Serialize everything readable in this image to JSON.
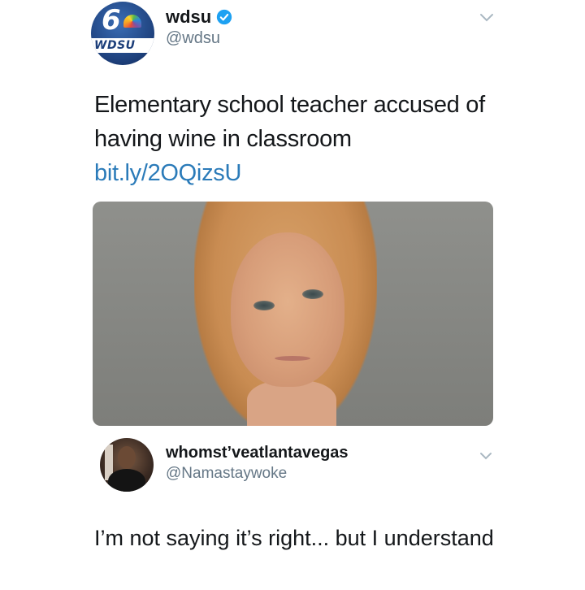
{
  "tweet": {
    "avatar_logo_number": "6",
    "avatar_logo_text": "WDSU",
    "display_name": "wdsu",
    "handle": "@wdsu",
    "text": "Elementary school teacher accused of having wine in classroom ",
    "link_text": "bit.ly/2OQizsU",
    "media_icon": "mugshot-photo"
  },
  "reply": {
    "display_name": "whomst’veatlantavegas",
    "handle": "@Namastaywoke",
    "text": "I’m not saying it’s right... but I understand"
  },
  "icons": {
    "verified": "verified-badge-icon",
    "chevron": "chevron-down-icon"
  },
  "colors": {
    "link": "#2b7bb9",
    "verified": "#1da1f2",
    "handle": "#657786",
    "text": "#14171a"
  }
}
